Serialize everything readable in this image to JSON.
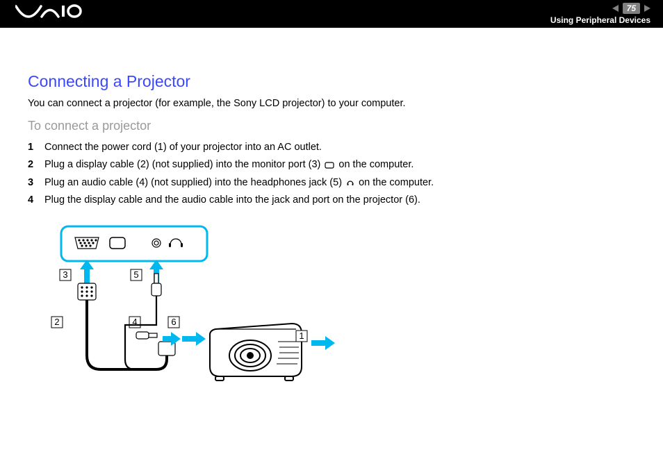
{
  "header": {
    "page_number": "75",
    "section_title": "Using Peripheral Devices"
  },
  "content": {
    "heading": "Connecting a Projector",
    "intro": "You can connect a projector (for example, the Sony LCD projector) to your computer.",
    "subheading": "To connect a projector",
    "steps": [
      "Connect the power cord (1) of your projector into an AC outlet.",
      "Plug a display cable (2) (not supplied) into the monitor port (3) ▢ on the computer.",
      "Plug an audio cable (4) (not supplied) into the headphones jack (5) ◌ on the computer.",
      "Plug the display cable and the audio cable into the jack and port on the projector (6)."
    ]
  },
  "diagram": {
    "labels": [
      "1",
      "2",
      "3",
      "4",
      "5",
      "6"
    ]
  }
}
